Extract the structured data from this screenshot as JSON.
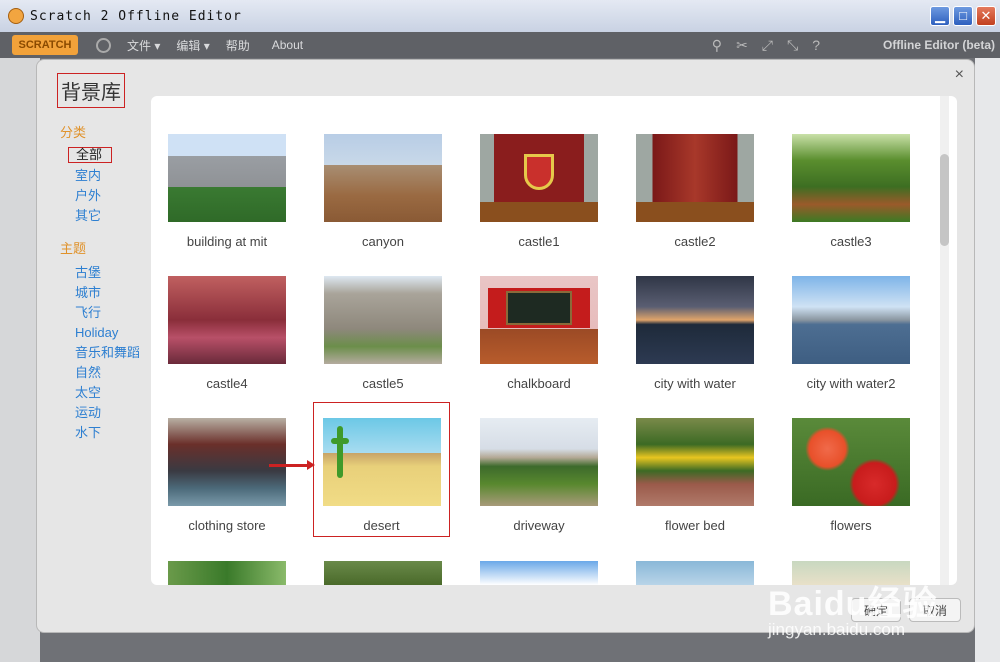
{
  "window": {
    "title": "Scratch 2 Offline Editor",
    "min": "▁",
    "max": "□",
    "close": "✕"
  },
  "menubar": {
    "logo": "SCRATCH",
    "file": "文件 ▾",
    "edit": "编辑 ▾",
    "help": "帮助",
    "about": "About",
    "editor_label": "Offline Editor (beta)"
  },
  "dialog": {
    "title": "背景库",
    "close": "×",
    "category_header": "分类",
    "categories": [
      "全部",
      "室内",
      "户外",
      "其它"
    ],
    "theme_header": "主题",
    "themes": [
      "古堡",
      "城市",
      "飞行",
      "Holiday",
      "音乐和舞蹈",
      "自然",
      "太空",
      "运动",
      "水下"
    ],
    "backdrops": [
      {
        "label": "building at mit"
      },
      {
        "label": "canyon"
      },
      {
        "label": "castle1"
      },
      {
        "label": "castle2"
      },
      {
        "label": "castle3"
      },
      {
        "label": "castle4"
      },
      {
        "label": "castle5"
      },
      {
        "label": "chalkboard"
      },
      {
        "label": "city with water"
      },
      {
        "label": "city with water2"
      },
      {
        "label": "clothing store"
      },
      {
        "label": "desert"
      },
      {
        "label": "driveway"
      },
      {
        "label": "flower bed"
      },
      {
        "label": "flowers"
      }
    ],
    "ok": "确定",
    "cancel": "取消"
  },
  "watermark": {
    "brand": "Baidu经验",
    "url": "jingyan.baidu.com"
  }
}
